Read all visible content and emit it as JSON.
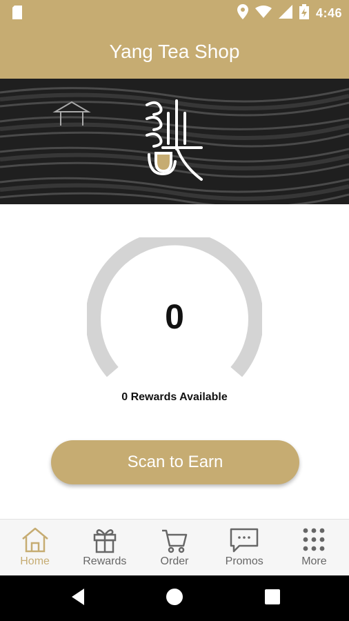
{
  "status_bar": {
    "time": "4:46"
  },
  "app_bar": {
    "title": "Yang Tea Shop"
  },
  "rewards": {
    "count": "0",
    "available_label": "0 Rewards Available"
  },
  "cta": {
    "scan_label": "Scan to Earn"
  },
  "bottom_nav": {
    "items": [
      {
        "label": "Home",
        "icon": "home-icon",
        "active": true
      },
      {
        "label": "Rewards",
        "icon": "gift-icon"
      },
      {
        "label": "Order",
        "icon": "cart-icon"
      },
      {
        "label": "Promos",
        "icon": "chat-icon"
      },
      {
        "label": "More",
        "icon": "grid-dots-icon"
      }
    ]
  },
  "colors": {
    "brand": "#c6ac72",
    "gauge_track": "#d4d4d4",
    "inactive": "#666666"
  }
}
